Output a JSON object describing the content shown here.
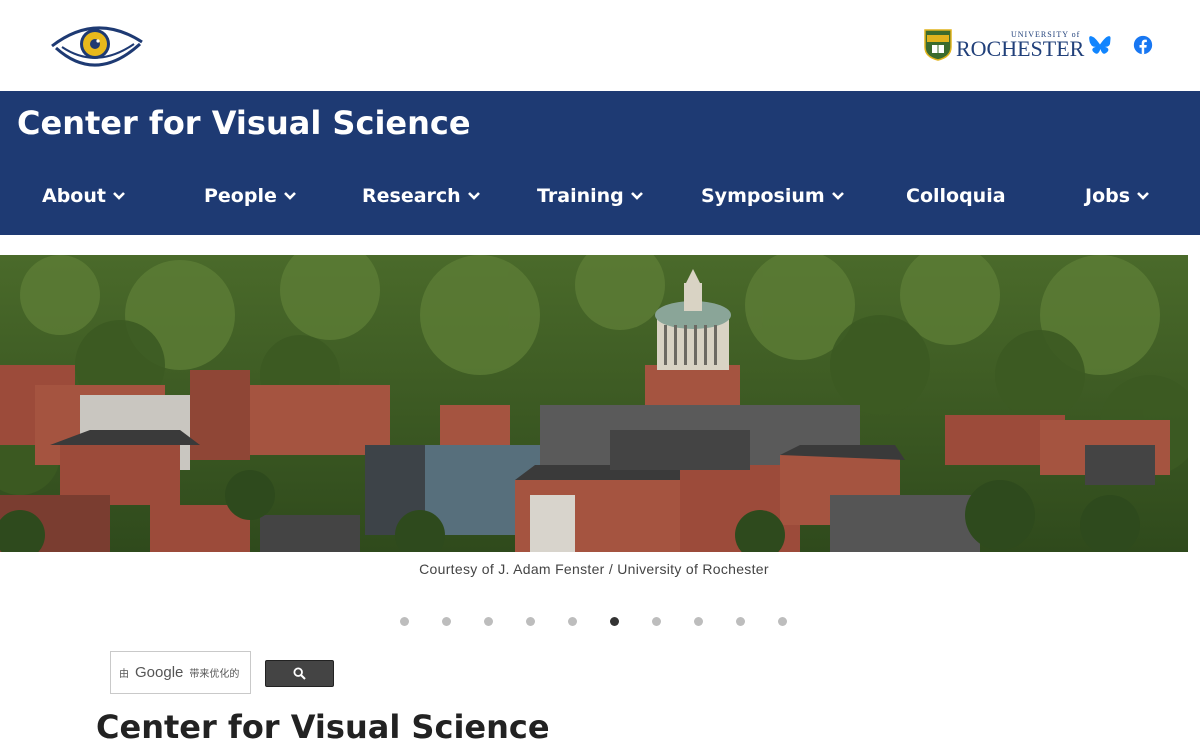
{
  "header": {
    "uofr_small": "UNIVERSITY of",
    "uofr_big": "ROCHESTER"
  },
  "site_title": "Center for Visual Science",
  "nav": [
    {
      "label": "About",
      "has_dropdown": true
    },
    {
      "label": "People",
      "has_dropdown": true
    },
    {
      "label": "Research",
      "has_dropdown": true
    },
    {
      "label": "Training",
      "has_dropdown": true
    },
    {
      "label": "Symposium",
      "has_dropdown": true
    },
    {
      "label": "Colloquia",
      "has_dropdown": false
    },
    {
      "label": "Jobs",
      "has_dropdown": true
    }
  ],
  "hero": {
    "caption": "Courtesy of J. Adam Fenster / University of Rochester"
  },
  "carousel": {
    "slide_count": 10,
    "active_index": 5
  },
  "search": {
    "by_label": "由",
    "provider": "Google",
    "enhanced_label": "带来优化的"
  },
  "main": {
    "heading": "Center for Visual Science"
  },
  "colors": {
    "brand_blue": "#1e3a73",
    "bluesky": "#1185fe",
    "facebook": "#1877f2"
  }
}
